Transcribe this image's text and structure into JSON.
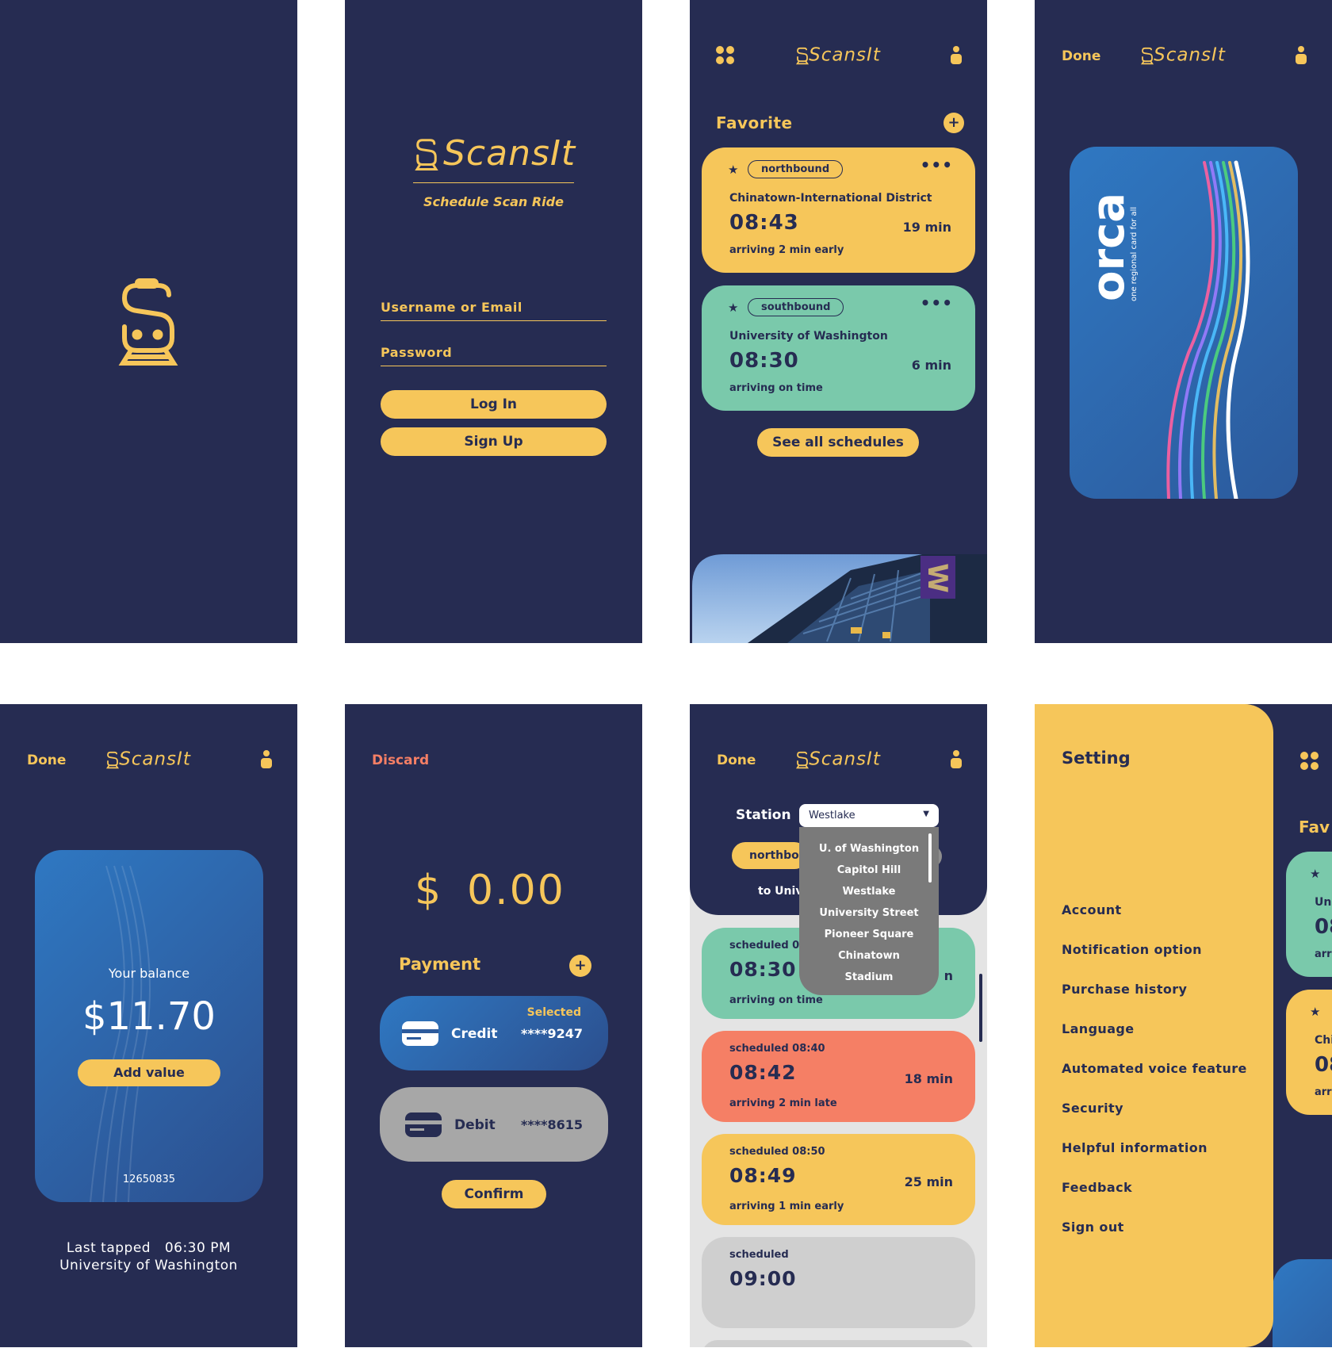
{
  "brand": {
    "name": "ScansIt",
    "tagline": "Schedule Scan Ride"
  },
  "colors": {
    "navy": "#262c52",
    "yellow": "#f6c65a",
    "green": "#7ac9ab",
    "coral": "#f57f65",
    "gray": "#cfcfcf",
    "blue": "#2f78c2"
  },
  "login": {
    "username_label": "Username or Email",
    "password_label": "Password",
    "login_button": "Log In",
    "signup_button": "Sign Up"
  },
  "home": {
    "section_title": "Favorite",
    "favorites": [
      {
        "direction": "northbound",
        "station": "Chinatown-International District",
        "time": "08:43",
        "minutes": "19 min",
        "status": "arriving 2 min early",
        "color": "#f6c65a"
      },
      {
        "direction": "southbound",
        "station": "University of Washington",
        "time": "08:30",
        "minutes": "6 min",
        "status": "arriving on time",
        "color": "#7ac9ab"
      }
    ],
    "see_all_button": "See all schedules"
  },
  "orca": {
    "done_label": "Done",
    "card_brand": "orca",
    "card_tagline": "one regional card for all"
  },
  "balance": {
    "done_label": "Done",
    "balance_label": "Your balance",
    "balance_amount": "$11.70",
    "add_value_button": "Add value",
    "card_number": "12650835",
    "last_tapped_label": "Last tapped",
    "last_tapped_time": "06:30 PM",
    "last_tapped_station": "University of Washington"
  },
  "payment": {
    "discard_label": "Discard",
    "currency": "$",
    "amount": "0.00",
    "payment_title": "Payment",
    "methods": [
      {
        "label": "Credit",
        "number": "****9247",
        "badge": "Selected"
      },
      {
        "label": "Debit",
        "number": "****8615",
        "badge": ""
      }
    ],
    "confirm_button": "Confirm"
  },
  "schedules": {
    "done_label": "Done",
    "station_label": "Station",
    "selected_station": "Westlake",
    "direction_chip": "northbou",
    "to_label": "to Univ",
    "dropdown_options": [
      "U. of Washington",
      "Capitol Hill",
      "Westlake",
      "University Street",
      "Pioneer Square",
      "Chinatown",
      "Stadium"
    ],
    "rows": [
      {
        "scheduled": "scheduled 0",
        "time": "08:30",
        "minutes": "n",
        "status": "arriving on time",
        "color": "#7ac9ab"
      },
      {
        "scheduled": "scheduled 08:40",
        "time": "08:42",
        "minutes": "18 min",
        "status": "arriving 2 min late",
        "color": "#f57f65"
      },
      {
        "scheduled": "scheduled 08:50",
        "time": "08:49",
        "minutes": "25 min",
        "status": "arriving 1 min early",
        "color": "#f6c65a"
      },
      {
        "scheduled": "scheduled",
        "time": "09:00",
        "minutes": "",
        "status": "",
        "color": "#cfcfcf"
      }
    ]
  },
  "settings": {
    "title": "Setting",
    "items": [
      "Account",
      "Notification option",
      "Purchase history",
      "Language",
      "Automated voice feature",
      "Security",
      "Helpful information",
      "Feedback",
      "Sign out"
    ],
    "peek_title": "Fav",
    "peek_card_1_station": "Uni",
    "peek_card_1_time": "08",
    "peek_card_1_status": "arr",
    "peek_card_2_station": "Chi",
    "peek_card_2_time": "08",
    "peek_card_2_status": "arr"
  }
}
